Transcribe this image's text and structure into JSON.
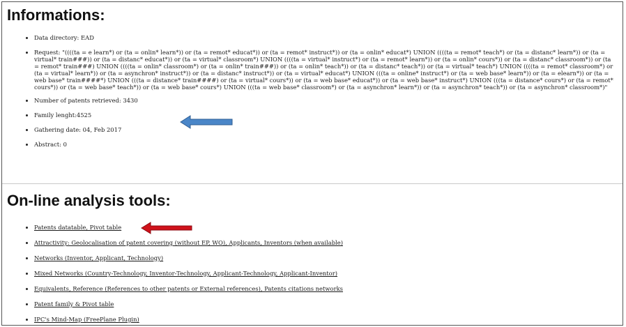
{
  "info": {
    "title": "Informations:",
    "data_directory": "Data directory: EAD",
    "request": "Request: \"((((ta = e learn*) or (ta = onlin* learn*)) or (ta = remot* educat*)) or (ta = remot* instruct*)) or (ta = onlin* educat*) UNION ((((ta = remot* teach*) or (ta = distanc* learn*)) or (ta = virtual* train###)) or (ta = distanc* educat*)) or (ta = virtual* classroom*) UNION ((((ta = virtual* instruct*) or (ta = remot* learn*)) or (ta = onlin* cours*)) or (ta = distanc* classroom*)) or (ta = remot* train###) UNION ((((ta = onlin* classroom*) or (ta = onlin* train###)) or (ta = onlin* teach*)) or (ta = distanc* teach*)) or (ta = virtual* teach*) UNION ((((ta = remot* classroom*) or (ta = virtual* learn*)) or (ta = asynchron* instruct*)) or (ta = distanc* instruct*)) or (ta = virtual* educat*) UNION (((ta = online* instruct*) or (ta = web base* learn*)) or (ta = elearn*)) or (ta = web base* train####*) UNION (((ta = distance* train####) or (ta = virtual* cours*)) or (ta = web base* educat*)) or (ta = web base* instruct*) UNION (((ta = distance* cours*) or (ta = remot* cours*)) or (ta = web base* teach*)) or (ta = web base* cours*) UNION (((ta = web base* classroom*) or (ta = asynchron* learn*)) or (ta = asynchron* teach*)) or (ta = asynchron* classroom*)\"",
    "patents_retrieved": "Number of patents retrieved: 3430",
    "family_length": "Family lenght:4525",
    "gathering_date": "Gathering date: 04, Feb 2017",
    "abstract": "Abstract: 0"
  },
  "tools": {
    "title": "On-line analysis tools:",
    "links": [
      "Patents datatable, Pivot table",
      "Attractivity: Geolocalisation of patent covering (without EP, WO), Applicants, Inventors (when available)",
      "Networks (Inventor, Applicant, Technology)",
      "Mixed Networks (Country-Technology, Inventor-Technology, Applicant-Technology, Applicant-Inventor)",
      "Equivalents, Reference (References to other patents or External references), Patents citations networks",
      "Patent family & Pivot table",
      "IPC's Mind-Map (FreePlane Plugin)"
    ]
  },
  "annotations": {
    "blue_arrow_color": "#4a86c8",
    "red_arrow_color": "#d0121b"
  }
}
